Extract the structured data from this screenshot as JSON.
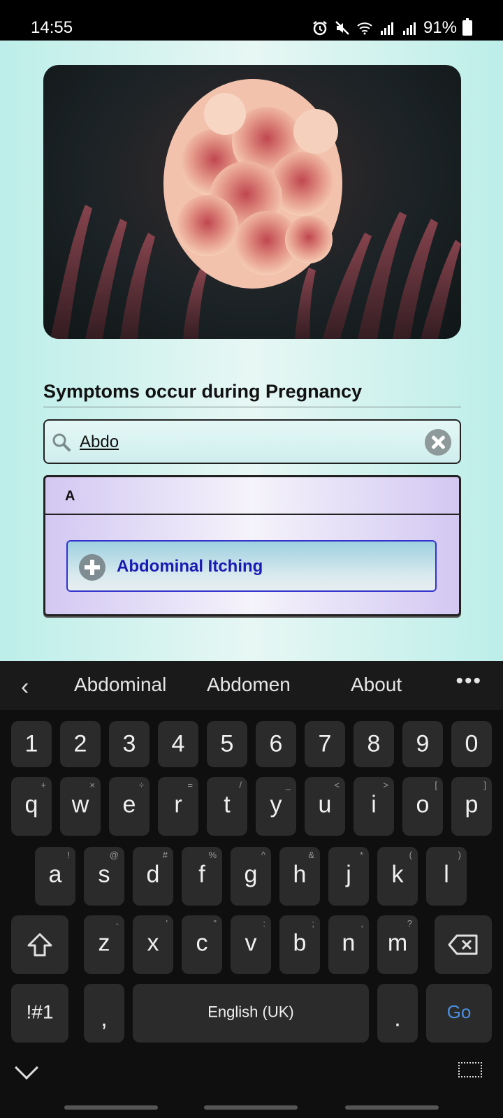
{
  "status": {
    "time": "14:55",
    "battery": "91%",
    "icons": [
      "alarm-icon",
      "mute-icon",
      "wifi-icon",
      "signal-icon",
      "signal-icon",
      "battery-icon"
    ]
  },
  "app": {
    "section_title": "Symptoms occur during Pregnancy",
    "search": {
      "value": "Abdo"
    },
    "results": {
      "group_header": "A",
      "items": [
        {
          "label": "Abdominal Itching"
        }
      ]
    }
  },
  "keyboard": {
    "suggestions": [
      "Abdominal",
      "Abdomen",
      "About"
    ],
    "more": "•••",
    "rows": {
      "numbers": [
        "1",
        "2",
        "3",
        "4",
        "5",
        "6",
        "7",
        "8",
        "9",
        "0"
      ],
      "row1": [
        "q",
        "w",
        "e",
        "r",
        "t",
        "y",
        "u",
        "i",
        "o",
        "p"
      ],
      "row1_hints": [
        "+",
        "×",
        "÷",
        "=",
        "/",
        "_",
        "<",
        ">",
        "[",
        "]"
      ],
      "row2": [
        "a",
        "s",
        "d",
        "f",
        "g",
        "h",
        "j",
        "k",
        "l"
      ],
      "row2_hints": [
        "!",
        "@",
        "#",
        "%",
        "^",
        "&",
        "*",
        "(",
        ")"
      ],
      "row3": [
        "z",
        "x",
        "c",
        "v",
        "b",
        "n",
        "m"
      ],
      "row3_hints": [
        "-",
        "'",
        "\"",
        ":",
        ";",
        ",",
        "?"
      ],
      "symbols": "!#1",
      "comma": ",",
      "space": "English (UK)",
      "period": ".",
      "go": "Go"
    }
  }
}
